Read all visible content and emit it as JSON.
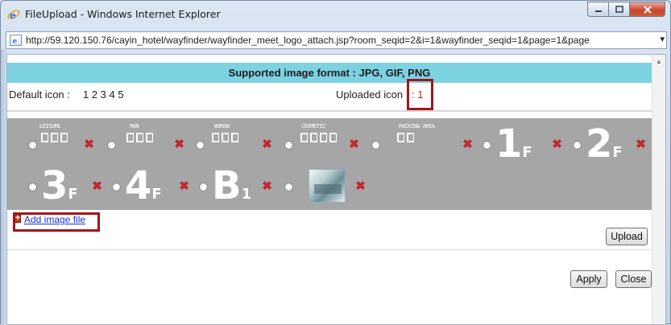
{
  "window": {
    "title": "FileUpload - Windows Internet Explorer",
    "url": "http://59.120.150.76/cayin_hotel/wayfinder/wayfinder_meet_logo_attach.jsp?room_seqid=2&i=1&wayfinder_seqid=1&page=1&page"
  },
  "header": {
    "supported_formats": "Supported image format : JPG, GIF, PNG"
  },
  "icons": {
    "default_label": "Default icon : ",
    "default_numbers": "1 2 3 4 5",
    "uploaded_label": "Uploaded icon",
    "uploaded_count": " : 1"
  },
  "gallery": {
    "row1": [
      {
        "label": "LEISURE",
        "type": "text-icon"
      },
      {
        "label": "MAN",
        "type": "text-icon"
      },
      {
        "label": "WOMAN",
        "type": "text-icon"
      },
      {
        "label": "COSMETIC",
        "type": "text-icon"
      },
      {
        "label": "PACKING AREA",
        "type": "text-icon"
      },
      {
        "main": "1",
        "sub": "F",
        "type": "floor"
      },
      {
        "main": "2",
        "sub": "F",
        "type": "floor"
      }
    ],
    "row2": [
      {
        "main": "3",
        "sub": "F",
        "type": "floor"
      },
      {
        "main": "4",
        "sub": "F",
        "type": "floor"
      },
      {
        "main": "B",
        "sub": "1",
        "type": "floor"
      },
      {
        "type": "photo"
      }
    ],
    "delete_icon": "close-x",
    "accent_red": "#c0282f"
  },
  "actions": {
    "add_image": "Add image file",
    "upload": "Upload",
    "apply": "Apply",
    "close": "Close"
  }
}
